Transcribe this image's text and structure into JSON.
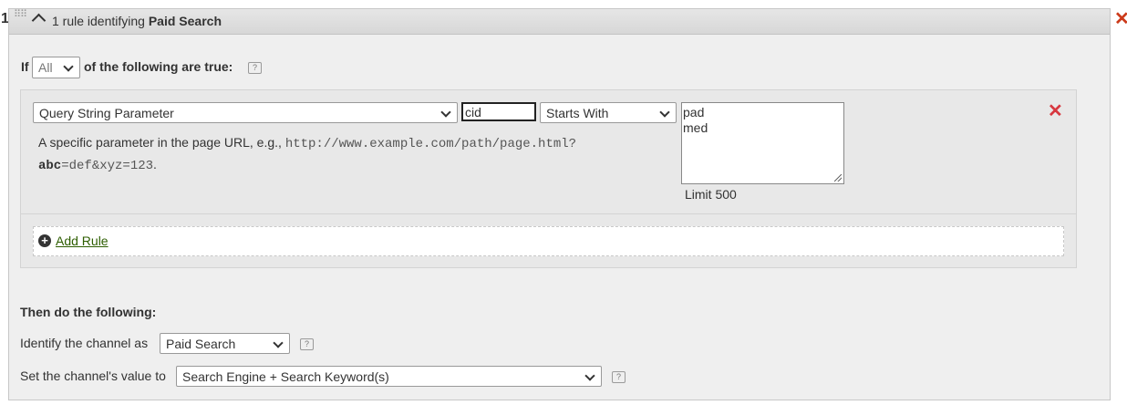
{
  "row_number": "1",
  "header": {
    "title_prefix": "1 rule identifying ",
    "title_strong": "Paid Search"
  },
  "condition": {
    "if_label": "If",
    "match_value": "All",
    "of_label": "of the following are true:"
  },
  "rule": {
    "dimension": "Query String Parameter",
    "parameter": "cid",
    "operator": "Starts With",
    "values_line1": "pad",
    "values_line2": "med",
    "limit": "Limit 500",
    "desc_text": "A specific parameter in the page URL, e.g., ",
    "desc_url": "http://www.example.com/path/page.html?",
    "desc_param": "abc",
    "desc_rest": "=def&xyz=123",
    "desc_end": "."
  },
  "add_rule": "Add Rule",
  "then": {
    "title": "Then do the following:",
    "identify_label": "Identify the channel as",
    "channel_value": "Paid Search",
    "value_label": "Set the channel's value to",
    "value_value": "Search Engine + Search Keyword(s)"
  },
  "colors": {
    "remove": "#d7373f",
    "link": "#2d5d00",
    "panel_bg": "#efefef"
  },
  "icons": [
    "drag-handle-icon",
    "chevron-up-icon",
    "close-icon",
    "help-icon",
    "add-circle-icon",
    "remove-icon"
  ]
}
